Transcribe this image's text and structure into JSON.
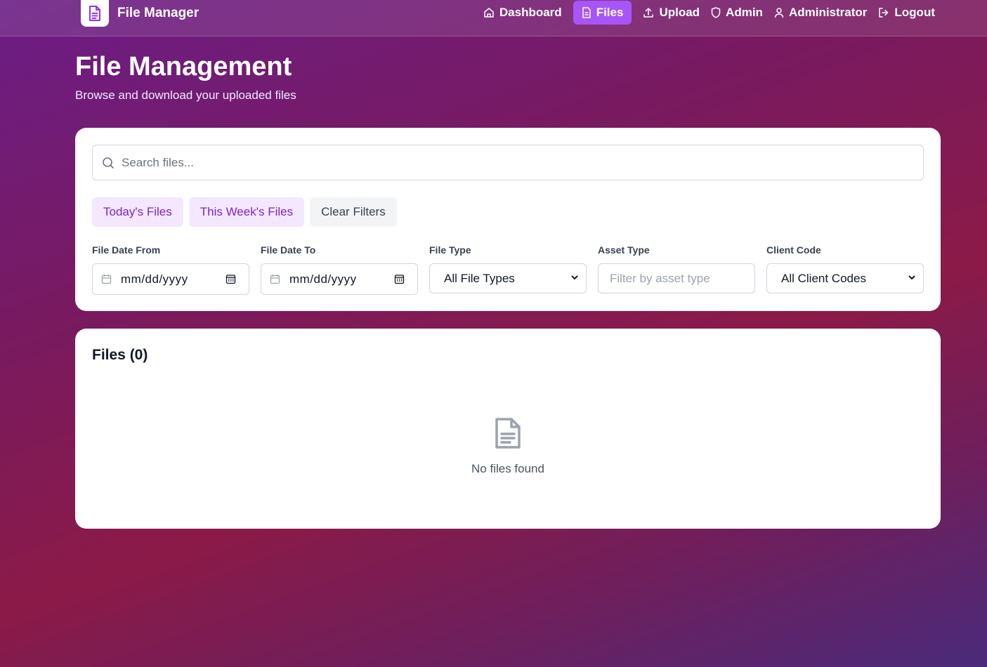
{
  "app": {
    "title": "File Manager"
  },
  "nav": {
    "items": [
      {
        "label": "Dashboard",
        "icon": "home-icon",
        "active": false
      },
      {
        "label": "Files",
        "icon": "file-icon",
        "active": true
      },
      {
        "label": "Upload",
        "icon": "upload-icon",
        "active": false
      },
      {
        "label": "Admin",
        "icon": "shield-icon",
        "active": false
      },
      {
        "label": "Administrator",
        "icon": "user-icon",
        "active": false
      },
      {
        "label": "Logout",
        "icon": "logout-icon",
        "active": false
      }
    ]
  },
  "page": {
    "title": "File Management",
    "subtitle": "Browse and download your uploaded files"
  },
  "search": {
    "placeholder": "Search files...",
    "value": ""
  },
  "quick_filters": {
    "today": "Today's Files",
    "week": "This Week's Files",
    "clear": "Clear Filters"
  },
  "filters": {
    "date_from": {
      "label": "File Date From",
      "value": "mm/dd/yyyy"
    },
    "date_to": {
      "label": "File Date To",
      "value": "mm/dd/yyyy"
    },
    "file_type": {
      "label": "File Type",
      "value": "All File Types"
    },
    "asset_type": {
      "label": "Asset Type",
      "placeholder": "Filter by asset type",
      "value": ""
    },
    "client_code": {
      "label": "Client Code",
      "value": "All Client Codes"
    }
  },
  "files": {
    "title": "Files (0)",
    "empty_message": "No files found"
  },
  "colors": {
    "accent": "#a855f7",
    "quick_purple_bg": "#f3e8ff",
    "quick_purple_text": "#7e22ce"
  }
}
